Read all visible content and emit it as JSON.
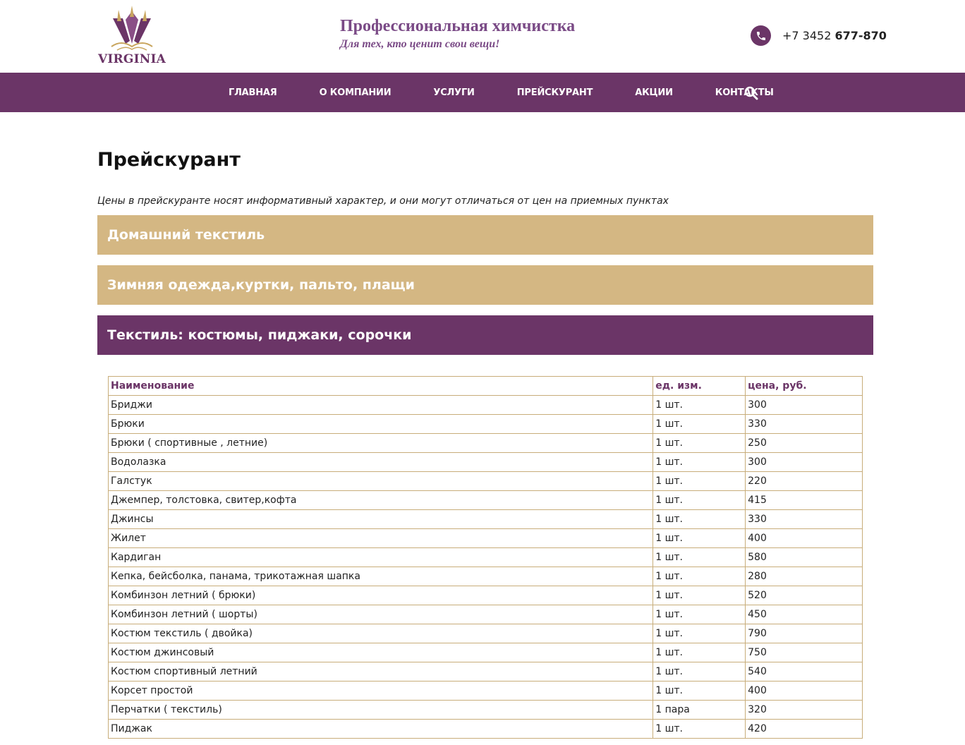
{
  "header": {
    "logo_text": "VIRGINIA",
    "slogan_title": "Профессиональная химчистка",
    "slogan_sub": "Для тех, кто ценит свои вещи!",
    "phone_prefix": "+7 3452",
    "phone_main": "677-870"
  },
  "nav": {
    "items": [
      {
        "label": "Главная"
      },
      {
        "label": "О компании"
      },
      {
        "label": "Услуги"
      },
      {
        "label": "Прейскурант"
      },
      {
        "label": "Акции"
      },
      {
        "label": "Контакты"
      }
    ]
  },
  "page": {
    "title": "Прейскурант",
    "note": "Цены в прейскуранте носят информативный характер, и они могут отличаться от цен на приемных пунктах"
  },
  "accordion": [
    {
      "label": "Домашний текстиль"
    },
    {
      "label": "Зимняя одежда,куртки, пальто, плащи"
    },
    {
      "label": "Текстиль: костюмы, пиджаки, сорочки"
    }
  ],
  "table": {
    "headers": [
      "Наименование",
      "ед. изм.",
      "цена, руб."
    ],
    "rows": [
      [
        "Бриджи",
        "1 шт.",
        "300"
      ],
      [
        "Брюки",
        "1 шт.",
        "330"
      ],
      [
        "Брюки ( спортивные , летние)",
        "1 шт.",
        "250"
      ],
      [
        "Водолазка",
        "1 шт.",
        "300"
      ],
      [
        "Галстук",
        "1 шт.",
        "220"
      ],
      [
        "Джемпер, толстовка, свитер,кофта",
        "1 шт.",
        "415"
      ],
      [
        "Джинсы",
        "1 шт.",
        "330"
      ],
      [
        "Жилет",
        "1 шт.",
        "400"
      ],
      [
        "Кардиган",
        "1 шт.",
        "580"
      ],
      [
        "Кепка, бейсболка, панама, трикотажная шапка",
        "1 шт.",
        "280"
      ],
      [
        "Комбинзон летний ( брюки)",
        "1 шт.",
        "520"
      ],
      [
        "Комбинзон летний ( шорты)",
        "1 шт.",
        "450"
      ],
      [
        "Костюм текстиль ( двойка)",
        "1 шт.",
        "790"
      ],
      [
        "Костюм джинсовый",
        "1 шт.",
        "750"
      ],
      [
        "Костюм спортивный летний",
        "1 шт.",
        "540"
      ],
      [
        "Корсет простой",
        "1 шт.",
        "400"
      ],
      [
        "Перчатки ( текстиль)",
        "1 пара",
        "320"
      ],
      [
        "Пиджак",
        "1 шт.",
        "420"
      ]
    ]
  },
  "colors": {
    "brand_purple": "#6b3567",
    "gold": "#d4b783",
    "slogan": "#7a4a86"
  }
}
